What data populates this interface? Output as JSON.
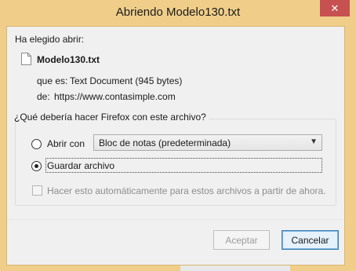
{
  "window": {
    "title": "Abriendo Modelo130.txt",
    "close_glyph": "✕",
    "frame_color": "#f0ce8a",
    "close_color": "#c75050"
  },
  "intro": {
    "heading": "Ha elegido abrir:",
    "file_icon": "document-icon",
    "filename": "Modelo130.txt",
    "type_label": "que es:",
    "type_value": "Text Document (945 bytes)",
    "from_label": "de:",
    "from_value": "https://www.contasimple.com"
  },
  "action_group": {
    "legend": "¿Qué debería hacer Firefox con este archivo?",
    "open_with": {
      "label": "Abrir con",
      "selected": false,
      "app_selected": "Bloc de notas (predeterminada)"
    },
    "save_file": {
      "label": "Guardar archivo",
      "selected": true
    },
    "remember": {
      "label": "Hacer esto automáticamente para estos archivos a partir de ahora.",
      "checked": false,
      "enabled": false
    }
  },
  "buttons": {
    "accept": "Aceptar",
    "cancel": "Cancelar"
  }
}
